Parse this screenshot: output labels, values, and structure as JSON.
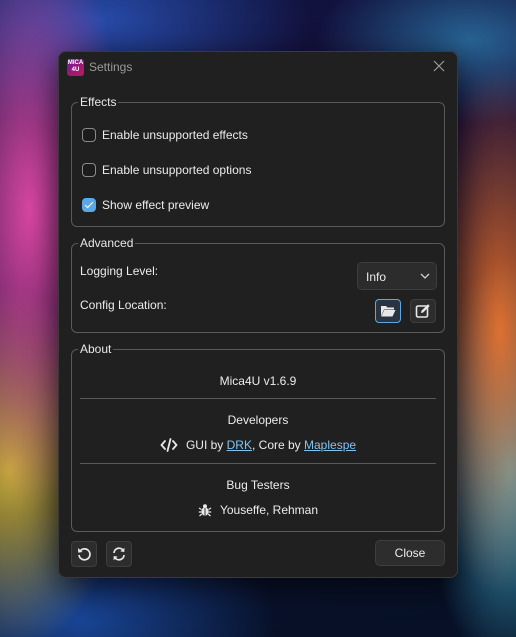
{
  "window": {
    "title": "Settings",
    "logo_text": "MICA 4U"
  },
  "effects": {
    "legend": "Effects",
    "options": [
      {
        "label": "Enable unsupported effects",
        "checked": false
      },
      {
        "label": "Enable unsupported options",
        "checked": false
      },
      {
        "label": "Show effect preview",
        "checked": true
      }
    ]
  },
  "advanced": {
    "legend": "Advanced",
    "logging_label": "Logging Level:",
    "logging_value": "Info",
    "config_label": "Config Location:",
    "icons": [
      "folder-open-icon",
      "edit-icon"
    ]
  },
  "about": {
    "legend": "About",
    "version": "Mica4U v1.6.9",
    "developers_title": "Developers",
    "gui_prefix": "GUI by",
    "gui_author": "DRK",
    "core_prefix": ", Core by",
    "core_author": "Maplespe",
    "testers_title": "Bug Testers",
    "testers": "Youseffe, Rehman"
  },
  "footer": {
    "close_label": "Close",
    "icons": [
      "undo-icon",
      "refresh-icon"
    ]
  },
  "colors": {
    "accent": "#5aa9e6",
    "window_bg": "#202020",
    "link": "#7fc4f0"
  }
}
